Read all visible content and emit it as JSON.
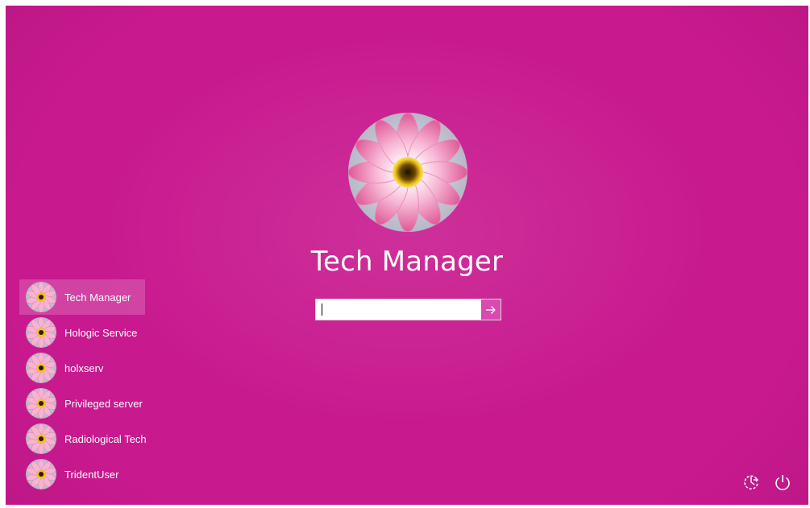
{
  "selected_user": {
    "name": "Tech Manager",
    "avatar_icon": "flower-avatar-icon"
  },
  "password": {
    "value": "",
    "submit_icon": "arrow-right-icon"
  },
  "users": [
    {
      "name": "Tech Manager",
      "selected": true
    },
    {
      "name": "Hologic Service",
      "selected": false
    },
    {
      "name": "holxserv",
      "selected": false
    },
    {
      "name": "Privileged server",
      "selected": false
    },
    {
      "name": "Radiological Tech",
      "selected": false
    },
    {
      "name": "TridentUser",
      "selected": false
    }
  ],
  "corner_buttons": {
    "ease_of_access_icon": "ease-of-access-icon",
    "power_icon": "power-icon"
  },
  "colors": {
    "background": "#c8198f",
    "submit_button": "#d84ab0",
    "text": "#ffffff"
  }
}
